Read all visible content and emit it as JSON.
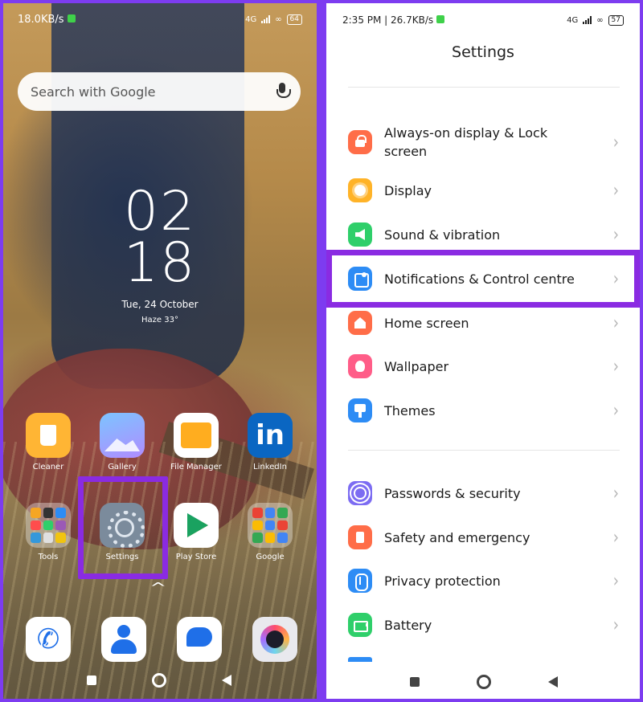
{
  "left_phone": {
    "status_bar": {
      "speed": "18.0KB/s",
      "network": "4G",
      "battery": "64"
    },
    "search": {
      "placeholder": "Search with Google"
    },
    "clock": {
      "hour": "02",
      "minute": "18"
    },
    "date": "Tue, 24 October",
    "weather": "Haze  33°",
    "apps": [
      {
        "label": "Cleaner",
        "icon": "cleaner-icon"
      },
      {
        "label": "Gallery",
        "icon": "gallery-icon"
      },
      {
        "label": "File Manager",
        "icon": "file-manager-icon"
      },
      {
        "label": "LinkedIn",
        "icon": "linkedin-icon",
        "glyph": "in"
      },
      {
        "label": "Tools",
        "icon": "tools-folder-icon"
      },
      {
        "label": "Settings",
        "icon": "settings-gear-icon"
      },
      {
        "label": "Play Store",
        "icon": "play-store-icon"
      },
      {
        "label": "Google",
        "icon": "google-folder-icon"
      }
    ],
    "dock": [
      "phone-icon",
      "contacts-icon",
      "messages-icon",
      "camera-icon"
    ]
  },
  "right_phone": {
    "status_bar": {
      "time_speed": "2:35 PM | 26.7KB/s",
      "network": "4G",
      "battery": "57"
    },
    "title": "Settings",
    "items": [
      {
        "label": "Always-on display & Lock screen",
        "icon": "lock-icon"
      },
      {
        "label": "Display",
        "icon": "display-icon"
      },
      {
        "label": "Sound & vibration",
        "icon": "sound-icon"
      },
      {
        "label": "Notifications & Control centre",
        "icon": "notifications-icon"
      },
      {
        "label": "Home screen",
        "icon": "home-icon"
      },
      {
        "label": "Wallpaper",
        "icon": "wallpaper-icon"
      },
      {
        "label": "Themes",
        "icon": "themes-icon"
      },
      {
        "label": "Passwords & security",
        "icon": "passwords-icon"
      },
      {
        "label": "Safety and emergency",
        "icon": "safety-icon"
      },
      {
        "label": "Privacy protection",
        "icon": "privacy-icon"
      },
      {
        "label": "Battery",
        "icon": "battery-icon"
      }
    ],
    "chevron": "›"
  },
  "colors": {
    "highlight": "#8a2be2",
    "blue": "#2d8cf5",
    "orange": "#ff6d48",
    "green": "#2fcf6a"
  }
}
